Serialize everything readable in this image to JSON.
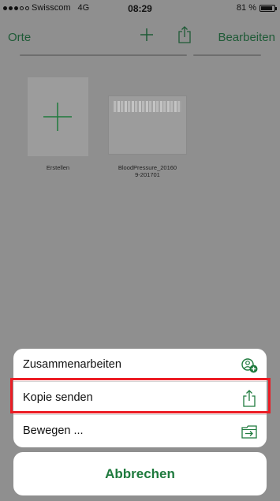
{
  "status_bar": {
    "carrier": "Swisscom",
    "network": "4G",
    "time": "08:29",
    "battery": "81 %"
  },
  "nav": {
    "left": "Orte",
    "right": "Bearbeiten",
    "icons": [
      "plus-icon",
      "share-icon"
    ]
  },
  "files": [
    {
      "label": "Erstellen",
      "icon": "plus-icon"
    },
    {
      "label_line1": "BloodPressure_20160",
      "label_line2": "9-201701"
    }
  ],
  "action_sheet": {
    "items": [
      {
        "label": "Zusammenarbeiten",
        "icon": "collaborate-icon"
      },
      {
        "label": "Kopie senden",
        "icon": "share-icon",
        "highlighted": true
      },
      {
        "label": "Bewegen ...",
        "icon": "move-folder-icon"
      }
    ],
    "cancel": "Abbrechen"
  },
  "colors": {
    "accent": "#1e7a3d",
    "nav_tint": "#1e5a36",
    "highlight": "#ec1c24",
    "overlay": "#8f8f8f"
  }
}
